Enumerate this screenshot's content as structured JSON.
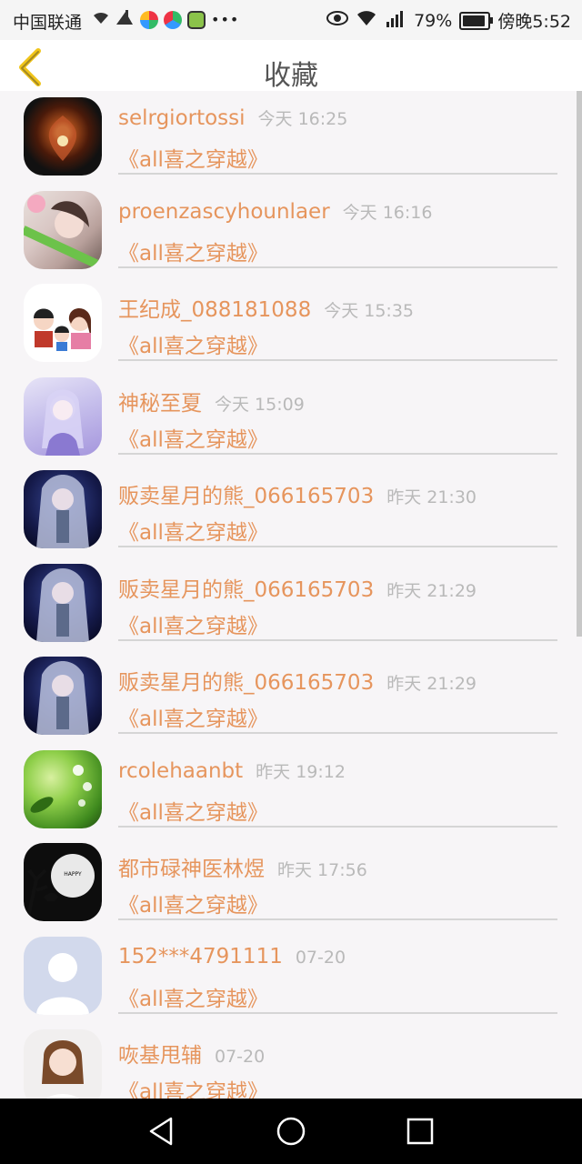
{
  "status_bar": {
    "carrier": "中国联通",
    "battery": "79%",
    "time": "傍晚5:52",
    "battery_level": 0.79,
    "icons": [
      "wifi-icon",
      "app-icon",
      "app-icon",
      "app-icon",
      "app-icon",
      "more-icon",
      "eye-icon",
      "wifi-icon",
      "signal-icon",
      "battery-icon"
    ]
  },
  "header": {
    "title": "收藏",
    "back_icon": "back-chevron-icon"
  },
  "colors": {
    "accent": "#e6955d",
    "timestamp": "#b9b9b9",
    "divider": "#d5d5d5",
    "back": "#f0c419"
  },
  "items": [
    {
      "name": "selrgiortossi",
      "time": "今天 16:25",
      "book": "《all喜之穿越》",
      "avatar": "flower-avatar"
    },
    {
      "name": "proenzascyhounlaer",
      "time": "今天 16:16",
      "book": "《all喜之穿越》",
      "avatar": "girl-avatar"
    },
    {
      "name": "王纪成_088181088",
      "time": "今天 15:35",
      "book": "《all喜之穿越》",
      "avatar": "family-avatar"
    },
    {
      "name": "神秘至夏",
      "time": "今天 15:09",
      "book": "《all喜之穿越》",
      "avatar": "anime-avatar"
    },
    {
      "name": "贩卖星月的熊_066165703",
      "time": "昨天 21:30",
      "book": "《all喜之穿越》",
      "avatar": "anime-dark-avatar"
    },
    {
      "name": "贩卖星月的熊_066165703",
      "time": "昨天 21:29",
      "book": "《all喜之穿越》",
      "avatar": "anime-dark-avatar"
    },
    {
      "name": "贩卖星月的熊_066165703",
      "time": "昨天 21:29",
      "book": "《all喜之穿越》",
      "avatar": "anime-dark-avatar"
    },
    {
      "name": "rcolehaanbt",
      "time": "昨天 19:12",
      "book": "《all喜之穿越》",
      "avatar": "green-nature-avatar"
    },
    {
      "name": "都市碌神医林煜",
      "time": "昨天 17:56",
      "book": "《all喜之穿越》",
      "avatar": "halloween-avatar"
    },
    {
      "name": "152***4791111",
      "time": "07-20",
      "book": "《all喜之穿越》",
      "avatar": "default-avatar"
    },
    {
      "name": "咴基甩辅",
      "time": "07-20",
      "book": "《all喜之穿越》",
      "avatar": "girl-photo-avatar"
    }
  ],
  "nav_bar": {
    "icons": [
      "back-triangle-icon",
      "home-circle-icon",
      "recents-square-icon"
    ]
  }
}
